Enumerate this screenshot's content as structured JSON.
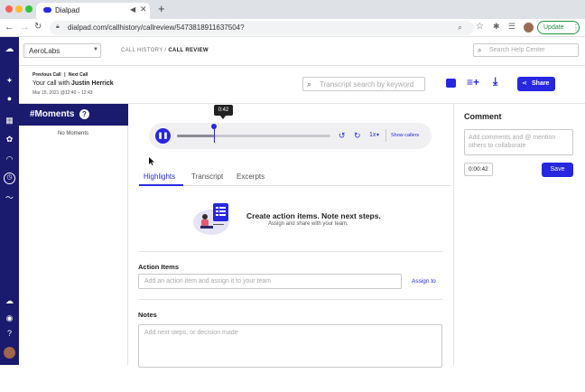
{
  "browser": {
    "tab_title": "Dialpad",
    "url": "dialpad.com/callhistory/callreview/5473818911637504?",
    "update_label": "Update"
  },
  "header": {
    "org_select": "AeroLabs",
    "breadcrumb_root": "CALL HISTORY /",
    "breadcrumb_current": "CALL REVIEW",
    "help_search_placeholder": "Search Help Center"
  },
  "call": {
    "prev_label": "Previous Call",
    "separator": "|",
    "next_label": "Next Call",
    "title_prefix": "Your call with",
    "contact": "Justin Herrick",
    "datetime": "Mar 15, 2021 @12:40 – 12:43",
    "transcript_search_placeholder": "Transcript search by keyword",
    "share_label": "Share"
  },
  "moments": {
    "title": "#Moments",
    "empty_text": "No Moments"
  },
  "player": {
    "time_tooltip": "0:42",
    "progress": 0.24,
    "speed": "1x",
    "show_callers": "Show callers"
  },
  "tabs": [
    {
      "label": "Highlights",
      "active": true
    },
    {
      "label": "Transcript",
      "active": false
    },
    {
      "label": "Excerpts",
      "active": false
    }
  ],
  "promo": {
    "headline": "Create action items. Note next steps.",
    "subtext": "Assign and share with your team."
  },
  "action_items": {
    "label": "Action Items",
    "placeholder": "Add an action item and assign it to your team",
    "assign_label": "Assign to"
  },
  "notes": {
    "label": "Notes",
    "placeholder": "Add next steps, or decision made"
  },
  "comment": {
    "title": "Comment",
    "placeholder": "Add comments and @ mention others to collaborate",
    "timestamp": "0:00:42",
    "save_label": "Save"
  },
  "colors": {
    "navy": "#1a1a6e",
    "accent": "#2727e0"
  }
}
